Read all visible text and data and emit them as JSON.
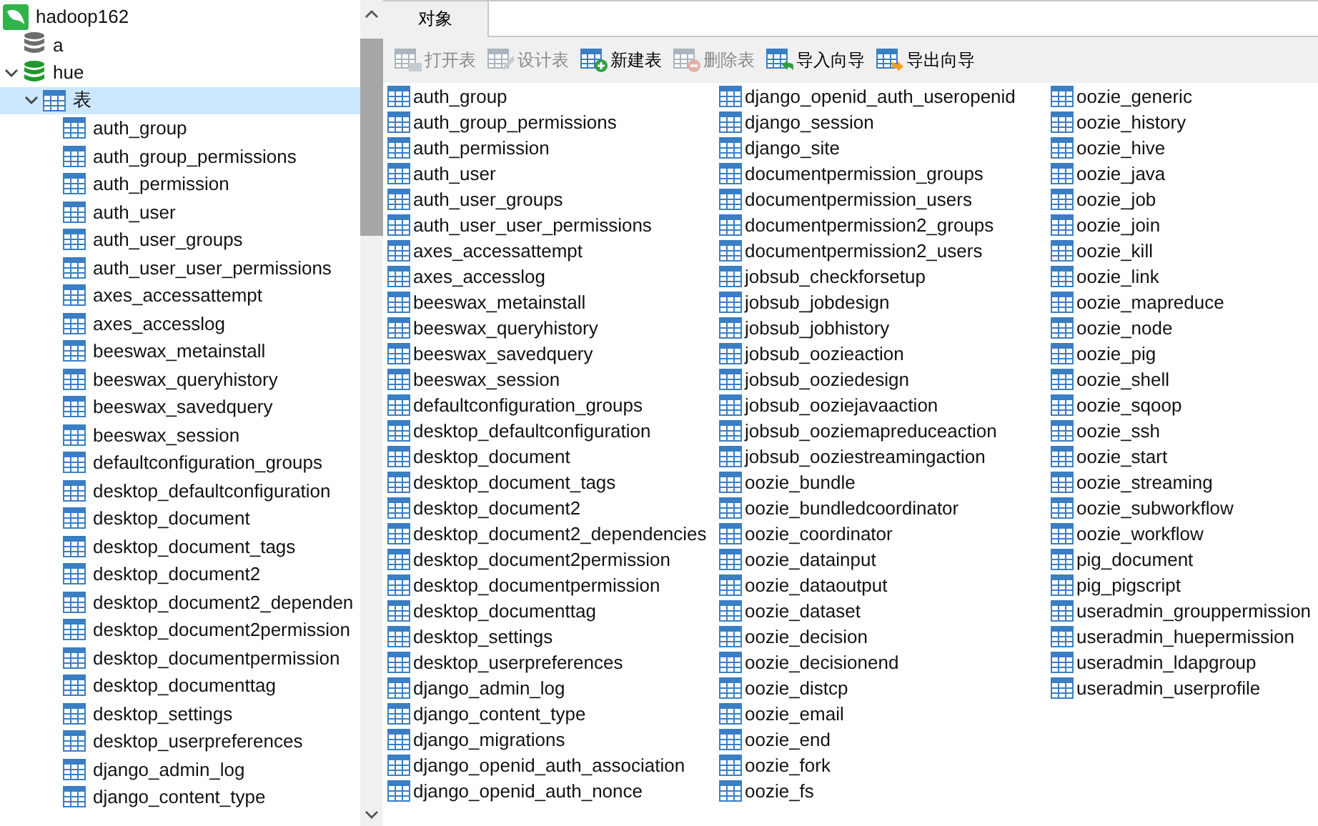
{
  "tree": {
    "name": "hadoop162",
    "kind": "connection",
    "selected": false,
    "children": [
      {
        "name": "a",
        "kind": "database",
        "connected": false,
        "selected": false
      },
      {
        "name": "hue",
        "kind": "database",
        "connected": true,
        "expanded": true,
        "selected": false,
        "children": [
          {
            "name": "表",
            "kind": "group",
            "expanded": true,
            "selected": true,
            "children": [
              {
                "name": "auth_group",
                "kind": "table",
                "selected": false
              },
              {
                "name": "auth_group_permissions",
                "kind": "table",
                "selected": false
              },
              {
                "name": "auth_permission",
                "kind": "table",
                "selected": false
              },
              {
                "name": "auth_user",
                "kind": "table",
                "selected": false
              },
              {
                "name": "auth_user_groups",
                "kind": "table",
                "selected": false
              },
              {
                "name": "auth_user_user_permissions",
                "kind": "table",
                "selected": false
              },
              {
                "name": "axes_accessattempt",
                "kind": "table",
                "selected": false
              },
              {
                "name": "axes_accesslog",
                "kind": "table",
                "selected": false
              },
              {
                "name": "beeswax_metainstall",
                "kind": "table",
                "selected": false
              },
              {
                "name": "beeswax_queryhistory",
                "kind": "table",
                "selected": false
              },
              {
                "name": "beeswax_savedquery",
                "kind": "table",
                "selected": false
              },
              {
                "name": "beeswax_session",
                "kind": "table",
                "selected": false
              },
              {
                "name": "defaultconfiguration_groups",
                "kind": "table",
                "selected": false
              },
              {
                "name": "desktop_defaultconfiguration",
                "kind": "table",
                "selected": false
              },
              {
                "name": "desktop_document",
                "kind": "table",
                "selected": false
              },
              {
                "name": "desktop_document_tags",
                "kind": "table",
                "selected": false
              },
              {
                "name": "desktop_document2",
                "kind": "table",
                "selected": false
              },
              {
                "name": "desktop_document2_dependen",
                "kind": "table",
                "selected": false
              },
              {
                "name": "desktop_document2permission",
                "kind": "table",
                "selected": false
              },
              {
                "name": "desktop_documentpermission",
                "kind": "table",
                "selected": false
              },
              {
                "name": "desktop_documenttag",
                "kind": "table",
                "selected": false
              },
              {
                "name": "desktop_settings",
                "kind": "table",
                "selected": false
              },
              {
                "name": "desktop_userpreferences",
                "kind": "table",
                "selected": false
              },
              {
                "name": "django_admin_log",
                "kind": "table",
                "selected": false
              },
              {
                "name": "django_content_type",
                "kind": "table",
                "selected": false
              }
            ]
          }
        ]
      }
    ]
  },
  "tabs": [
    {
      "label": "对象",
      "selected": true
    }
  ],
  "toolbar": [
    {
      "label": "打开表",
      "kind": "open",
      "disabled": true
    },
    {
      "label": "设计表",
      "kind": "design",
      "disabled": true
    },
    {
      "label": "新建表",
      "kind": "new",
      "disabled": false
    },
    {
      "label": "删除表",
      "kind": "delete",
      "disabled": true
    },
    {
      "label": "导入向导",
      "kind": "import",
      "disabled": false
    },
    {
      "label": "导出向导",
      "kind": "export",
      "disabled": false
    }
  ],
  "objects": [
    {
      "name": "auth_group",
      "selected": false
    },
    {
      "name": "auth_group_permissions",
      "selected": false
    },
    {
      "name": "auth_permission",
      "selected": false
    },
    {
      "name": "auth_user",
      "selected": false
    },
    {
      "name": "auth_user_groups",
      "selected": false
    },
    {
      "name": "auth_user_user_permissions",
      "selected": false
    },
    {
      "name": "axes_accessattempt",
      "selected": false
    },
    {
      "name": "axes_accesslog",
      "selected": false
    },
    {
      "name": "beeswax_metainstall",
      "selected": false
    },
    {
      "name": "beeswax_queryhistory",
      "selected": false
    },
    {
      "name": "beeswax_savedquery",
      "selected": false
    },
    {
      "name": "beeswax_session",
      "selected": false
    },
    {
      "name": "defaultconfiguration_groups",
      "selected": false
    },
    {
      "name": "desktop_defaultconfiguration",
      "selected": false
    },
    {
      "name": "desktop_document",
      "selected": false
    },
    {
      "name": "desktop_document_tags",
      "selected": false
    },
    {
      "name": "desktop_document2",
      "selected": false
    },
    {
      "name": "desktop_document2_dependencies",
      "selected": false
    },
    {
      "name": "desktop_document2permission",
      "selected": false
    },
    {
      "name": "desktop_documentpermission",
      "selected": false
    },
    {
      "name": "desktop_documenttag",
      "selected": false
    },
    {
      "name": "desktop_settings",
      "selected": false
    },
    {
      "name": "desktop_userpreferences",
      "selected": false
    },
    {
      "name": "django_admin_log",
      "selected": false
    },
    {
      "name": "django_content_type",
      "selected": false
    },
    {
      "name": "django_migrations",
      "selected": false
    },
    {
      "name": "django_openid_auth_association",
      "selected": false
    },
    {
      "name": "django_openid_auth_nonce",
      "selected": false
    },
    {
      "name": "django_openid_auth_useropenid",
      "selected": false
    },
    {
      "name": "django_session",
      "selected": false
    },
    {
      "name": "django_site",
      "selected": false
    },
    {
      "name": "documentpermission_groups",
      "selected": false
    },
    {
      "name": "documentpermission_users",
      "selected": false
    },
    {
      "name": "documentpermission2_groups",
      "selected": false
    },
    {
      "name": "documentpermission2_users",
      "selected": false
    },
    {
      "name": "jobsub_checkforsetup",
      "selected": false
    },
    {
      "name": "jobsub_jobdesign",
      "selected": false
    },
    {
      "name": "jobsub_jobhistory",
      "selected": false
    },
    {
      "name": "jobsub_oozieaction",
      "selected": false
    },
    {
      "name": "jobsub_ooziedesign",
      "selected": false
    },
    {
      "name": "jobsub_ooziejavaaction",
      "selected": false
    },
    {
      "name": "jobsub_ooziemapreduceaction",
      "selected": false
    },
    {
      "name": "jobsub_ooziestreamingaction",
      "selected": false
    },
    {
      "name": "oozie_bundle",
      "selected": false
    },
    {
      "name": "oozie_bundledcoordinator",
      "selected": false
    },
    {
      "name": "oozie_coordinator",
      "selected": false
    },
    {
      "name": "oozie_datainput",
      "selected": false
    },
    {
      "name": "oozie_dataoutput",
      "selected": false
    },
    {
      "name": "oozie_dataset",
      "selected": false
    },
    {
      "name": "oozie_decision",
      "selected": false
    },
    {
      "name": "oozie_decisionend",
      "selected": false
    },
    {
      "name": "oozie_distcp",
      "selected": false
    },
    {
      "name": "oozie_email",
      "selected": false
    },
    {
      "name": "oozie_end",
      "selected": false
    },
    {
      "name": "oozie_fork",
      "selected": false
    },
    {
      "name": "oozie_fs",
      "selected": false
    },
    {
      "name": "oozie_generic",
      "selected": false
    },
    {
      "name": "oozie_history",
      "selected": false
    },
    {
      "name": "oozie_hive",
      "selected": false
    },
    {
      "name": "oozie_java",
      "selected": false
    },
    {
      "name": "oozie_job",
      "selected": false
    },
    {
      "name": "oozie_join",
      "selected": false
    },
    {
      "name": "oozie_kill",
      "selected": false
    },
    {
      "name": "oozie_link",
      "selected": false
    },
    {
      "name": "oozie_mapreduce",
      "selected": false
    },
    {
      "name": "oozie_node",
      "selected": false
    },
    {
      "name": "oozie_pig",
      "selected": false
    },
    {
      "name": "oozie_shell",
      "selected": false
    },
    {
      "name": "oozie_sqoop",
      "selected": false
    },
    {
      "name": "oozie_ssh",
      "selected": false
    },
    {
      "name": "oozie_start",
      "selected": false
    },
    {
      "name": "oozie_streaming",
      "selected": false
    },
    {
      "name": "oozie_subworkflow",
      "selected": false
    },
    {
      "name": "oozie_workflow",
      "selected": false
    },
    {
      "name": "pig_document",
      "selected": false
    },
    {
      "name": "pig_pigscript",
      "selected": false
    },
    {
      "name": "useradmin_grouppermission",
      "selected": false
    },
    {
      "name": "useradmin_huepermission",
      "selected": false
    },
    {
      "name": "useradmin_ldapgroup",
      "selected": false
    },
    {
      "name": "useradmin_userprofile",
      "selected": false
    }
  ]
}
